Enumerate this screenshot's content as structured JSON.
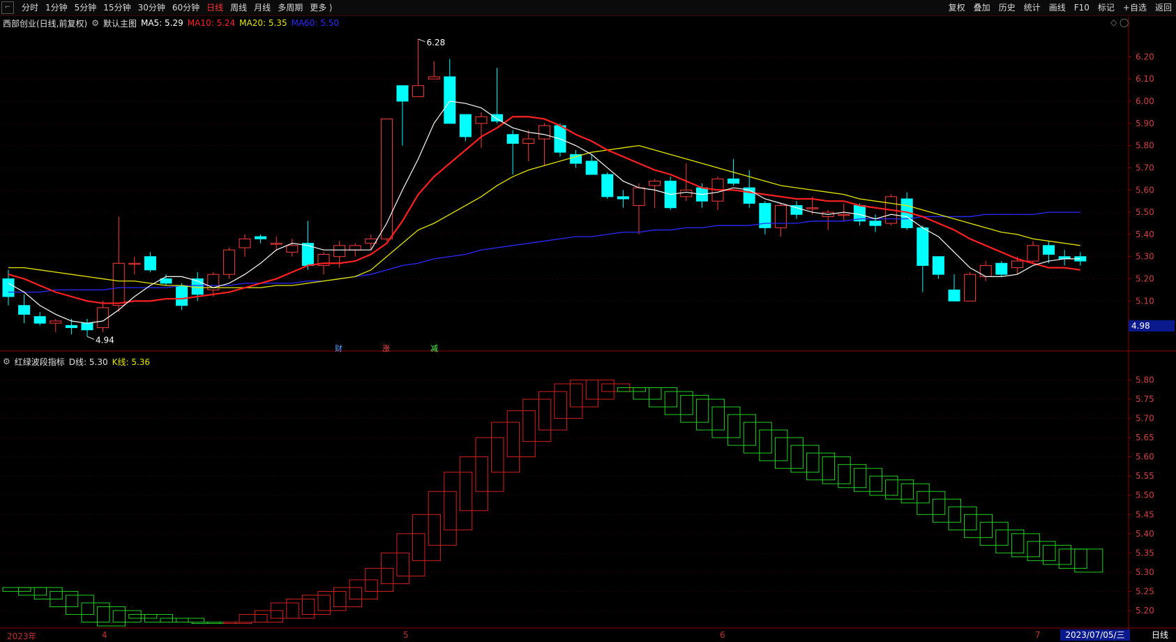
{
  "toolbar": {
    "left_tabs": [
      "分时",
      "1分钟",
      "5分钟",
      "15分钟",
      "30分钟",
      "60分钟",
      "日线",
      "周线",
      "月线",
      "多周期",
      "更多 ⟩"
    ],
    "active_tab": "日线",
    "right_buttons": [
      "复权",
      "叠加",
      "历史",
      "统计",
      "画线",
      "F10",
      "+自选",
      "返回"
    ],
    "right_buttons_note": "",
    "extra_right": "标记"
  },
  "main": {
    "stock_title": "西部创业(日线,前复权)",
    "main_chart_label": "默认主图",
    "ma5": "MA5: 5.29",
    "ma10": "MA10: 5.24",
    "ma20": "MA20: 5.35",
    "ma60": "MA60: 5.50",
    "high_label": "6.28",
    "low_label": "4.94",
    "price_badge": "4.98",
    "event_labels": [
      "财",
      "涨",
      "减"
    ]
  },
  "indicator": {
    "title": "红绿波段指标",
    "d_line": "D线: 5.30",
    "k_line": "K线: 5.36"
  },
  "xaxis": {
    "labels": [
      "2023年",
      "4",
      "5",
      "6",
      "7"
    ],
    "date_badge": "2023/07/05/三",
    "period": "日线"
  },
  "colors": {
    "up": "#ff3b3b",
    "down": "#00ffff",
    "ma5": "#ffffff",
    "ma10": "#ff2020",
    "ma20": "#e6e600",
    "ma60": "#2a2aff",
    "band_up": "#d42020",
    "band_down": "#20d020"
  },
  "chart_data": [
    {
      "type": "candlestick",
      "title": "西部创业(日线,前复权)",
      "y_ticks": [
        6.2,
        6.1,
        6.0,
        5.9,
        5.8,
        5.7,
        5.6,
        5.5,
        5.4,
        5.3,
        5.2,
        5.1
      ],
      "ylim": [
        4.9,
        6.33
      ],
      "candles": [
        {
          "o": 5.2,
          "h": 5.24,
          "l": 5.08,
          "c": 5.12
        },
        {
          "o": 5.08,
          "h": 5.13,
          "l": 5.0,
          "c": 5.04
        },
        {
          "o": 5.03,
          "h": 5.05,
          "l": 4.99,
          "c": 5.0
        },
        {
          "o": 5.0,
          "h": 5.02,
          "l": 4.96,
          "c": 5.01
        },
        {
          "o": 4.99,
          "h": 5.02,
          "l": 4.95,
          "c": 4.98
        },
        {
          "o": 5.0,
          "h": 5.02,
          "l": 4.94,
          "c": 4.97
        },
        {
          "o": 4.98,
          "h": 5.1,
          "l": 4.96,
          "c": 5.07
        },
        {
          "o": 5.08,
          "h": 5.48,
          "l": 5.05,
          "c": 5.27
        },
        {
          "o": 5.27,
          "h": 5.3,
          "l": 5.22,
          "c": 5.27
        },
        {
          "o": 5.3,
          "h": 5.32,
          "l": 5.23,
          "c": 5.24
        },
        {
          "o": 5.2,
          "h": 5.22,
          "l": 5.17,
          "c": 5.18
        },
        {
          "o": 5.17,
          "h": 5.18,
          "l": 5.06,
          "c": 5.08
        },
        {
          "o": 5.2,
          "h": 5.23,
          "l": 5.1,
          "c": 5.13
        },
        {
          "o": 5.15,
          "h": 5.23,
          "l": 5.12,
          "c": 5.22
        },
        {
          "o": 5.22,
          "h": 5.34,
          "l": 5.2,
          "c": 5.33
        },
        {
          "o": 5.34,
          "h": 5.4,
          "l": 5.3,
          "c": 5.38
        },
        {
          "o": 5.39,
          "h": 5.4,
          "l": 5.36,
          "c": 5.38
        },
        {
          "o": 5.36,
          "h": 5.39,
          "l": 5.33,
          "c": 5.36
        },
        {
          "o": 5.32,
          "h": 5.38,
          "l": 5.3,
          "c": 5.35
        },
        {
          "o": 5.36,
          "h": 5.46,
          "l": 5.24,
          "c": 5.26
        },
        {
          "o": 5.26,
          "h": 5.32,
          "l": 5.22,
          "c": 5.31
        },
        {
          "o": 5.3,
          "h": 5.37,
          "l": 5.25,
          "c": 5.35
        },
        {
          "o": 5.33,
          "h": 5.36,
          "l": 5.3,
          "c": 5.35
        },
        {
          "o": 5.36,
          "h": 5.4,
          "l": 5.33,
          "c": 5.38
        },
        {
          "o": 5.38,
          "h": 5.92,
          "l": 5.37,
          "c": 5.92
        },
        {
          "o": 6.07,
          "h": 6.07,
          "l": 5.8,
          "c": 6.0
        },
        {
          "o": 6.02,
          "h": 6.28,
          "l": 6.02,
          "c": 6.07
        },
        {
          "o": 6.1,
          "h": 6.18,
          "l": 6.1,
          "c": 6.11
        },
        {
          "o": 6.11,
          "h": 6.19,
          "l": 5.9,
          "c": 5.9
        },
        {
          "o": 5.94,
          "h": 5.94,
          "l": 5.82,
          "c": 5.84
        },
        {
          "o": 5.9,
          "h": 5.95,
          "l": 5.79,
          "c": 5.93
        },
        {
          "o": 5.94,
          "h": 6.15,
          "l": 5.9,
          "c": 5.91
        },
        {
          "o": 5.85,
          "h": 5.87,
          "l": 5.67,
          "c": 5.81
        },
        {
          "o": 5.81,
          "h": 5.87,
          "l": 5.73,
          "c": 5.83
        },
        {
          "o": 5.83,
          "h": 5.9,
          "l": 5.71,
          "c": 5.89
        },
        {
          "o": 5.89,
          "h": 5.9,
          "l": 5.75,
          "c": 5.77
        },
        {
          "o": 5.76,
          "h": 5.78,
          "l": 5.7,
          "c": 5.72
        },
        {
          "o": 5.73,
          "h": 5.76,
          "l": 5.67,
          "c": 5.67
        },
        {
          "o": 5.67,
          "h": 5.68,
          "l": 5.56,
          "c": 5.57
        },
        {
          "o": 5.57,
          "h": 5.6,
          "l": 5.52,
          "c": 5.56
        },
        {
          "o": 5.53,
          "h": 5.63,
          "l": 5.4,
          "c": 5.61
        },
        {
          "o": 5.62,
          "h": 5.65,
          "l": 5.52,
          "c": 5.64
        },
        {
          "o": 5.64,
          "h": 5.66,
          "l": 5.51,
          "c": 5.52
        },
        {
          "o": 5.57,
          "h": 5.72,
          "l": 5.55,
          "c": 5.6
        },
        {
          "o": 5.61,
          "h": 5.63,
          "l": 5.52,
          "c": 5.55
        },
        {
          "o": 5.55,
          "h": 5.66,
          "l": 5.51,
          "c": 5.65
        },
        {
          "o": 5.65,
          "h": 5.74,
          "l": 5.62,
          "c": 5.63
        },
        {
          "o": 5.61,
          "h": 5.69,
          "l": 5.52,
          "c": 5.54
        },
        {
          "o": 5.54,
          "h": 5.55,
          "l": 5.4,
          "c": 5.43
        },
        {
          "o": 5.43,
          "h": 5.54,
          "l": 5.39,
          "c": 5.53
        },
        {
          "o": 5.53,
          "h": 5.55,
          "l": 5.47,
          "c": 5.49
        },
        {
          "o": 5.52,
          "h": 5.57,
          "l": 5.49,
          "c": 5.52
        },
        {
          "o": 5.48,
          "h": 5.51,
          "l": 5.42,
          "c": 5.5
        },
        {
          "o": 5.49,
          "h": 5.54,
          "l": 5.46,
          "c": 5.49
        },
        {
          "o": 5.53,
          "h": 5.54,
          "l": 5.44,
          "c": 5.46
        },
        {
          "o": 5.46,
          "h": 5.49,
          "l": 5.41,
          "c": 5.44
        },
        {
          "o": 5.45,
          "h": 5.58,
          "l": 5.44,
          "c": 5.57
        },
        {
          "o": 5.56,
          "h": 5.59,
          "l": 5.42,
          "c": 5.43
        },
        {
          "o": 5.43,
          "h": 5.44,
          "l": 5.14,
          "c": 5.26
        },
        {
          "o": 5.3,
          "h": 5.3,
          "l": 5.2,
          "c": 5.22
        },
        {
          "o": 5.15,
          "h": 5.22,
          "l": 5.1,
          "c": 5.1
        },
        {
          "o": 5.1,
          "h": 5.23,
          "l": 5.1,
          "c": 5.22
        },
        {
          "o": 5.21,
          "h": 5.28,
          "l": 5.19,
          "c": 5.26
        },
        {
          "o": 5.27,
          "h": 5.28,
          "l": 5.21,
          "c": 5.22
        },
        {
          "o": 5.25,
          "h": 5.3,
          "l": 5.22,
          "c": 5.28
        },
        {
          "o": 5.28,
          "h": 5.37,
          "l": 5.27,
          "c": 5.35
        },
        {
          "o": 5.35,
          "h": 5.37,
          "l": 5.27,
          "c": 5.31
        },
        {
          "o": 5.3,
          "h": 5.33,
          "l": 5.26,
          "c": 5.29
        },
        {
          "o": 5.3,
          "h": 5.32,
          "l": 5.26,
          "c": 5.28
        }
      ],
      "ma5": [
        5.18,
        5.14,
        5.08,
        5.04,
        5.01,
        5.0,
        5.01,
        5.06,
        5.12,
        5.17,
        5.21,
        5.21,
        5.19,
        5.16,
        5.18,
        5.22,
        5.27,
        5.33,
        5.36,
        5.35,
        5.33,
        5.33,
        5.33,
        5.33,
        5.45,
        5.6,
        5.74,
        5.9,
        6.0,
        5.99,
        5.97,
        5.92,
        5.88,
        5.86,
        5.85,
        5.83,
        5.8,
        5.76,
        5.7,
        5.64,
        5.61,
        5.6,
        5.58,
        5.59,
        5.58,
        5.59,
        5.61,
        5.6,
        5.56,
        5.54,
        5.52,
        5.5,
        5.49,
        5.5,
        5.49,
        5.47,
        5.49,
        5.48,
        5.43,
        5.39,
        5.32,
        5.25,
        5.21,
        5.21,
        5.22,
        5.26,
        5.28,
        5.29,
        5.29
      ],
      "ma10": [
        5.22,
        5.2,
        5.17,
        5.14,
        5.12,
        5.1,
        5.09,
        5.09,
        5.1,
        5.1,
        5.11,
        5.11,
        5.12,
        5.13,
        5.14,
        5.16,
        5.18,
        5.2,
        5.23,
        5.26,
        5.27,
        5.27,
        5.28,
        5.31,
        5.36,
        5.46,
        5.58,
        5.66,
        5.72,
        5.78,
        5.84,
        5.88,
        5.93,
        5.93,
        5.92,
        5.89,
        5.85,
        5.82,
        5.78,
        5.75,
        5.72,
        5.69,
        5.67,
        5.64,
        5.61,
        5.6,
        5.6,
        5.59,
        5.58,
        5.57,
        5.56,
        5.56,
        5.55,
        5.55,
        5.53,
        5.52,
        5.51,
        5.5,
        5.48,
        5.45,
        5.42,
        5.38,
        5.35,
        5.32,
        5.29,
        5.27,
        5.25,
        5.25,
        5.24
      ],
      "ma20": [
        5.25,
        5.25,
        5.24,
        5.23,
        5.22,
        5.21,
        5.2,
        5.19,
        5.19,
        5.18,
        5.17,
        5.17,
        5.16,
        5.16,
        5.16,
        5.16,
        5.16,
        5.17,
        5.17,
        5.18,
        5.19,
        5.2,
        5.21,
        5.24,
        5.3,
        5.36,
        5.42,
        5.45,
        5.49,
        5.53,
        5.57,
        5.62,
        5.66,
        5.69,
        5.71,
        5.73,
        5.75,
        5.77,
        5.78,
        5.79,
        5.8,
        5.78,
        5.76,
        5.74,
        5.72,
        5.7,
        5.68,
        5.66,
        5.64,
        5.62,
        5.61,
        5.6,
        5.59,
        5.58,
        5.56,
        5.55,
        5.54,
        5.53,
        5.51,
        5.49,
        5.47,
        5.45,
        5.43,
        5.41,
        5.4,
        5.38,
        5.37,
        5.36,
        5.35
      ],
      "ma60": [
        5.14,
        5.14,
        5.14,
        5.15,
        5.15,
        5.15,
        5.15,
        5.16,
        5.16,
        5.16,
        5.16,
        5.17,
        5.17,
        5.17,
        5.17,
        5.18,
        5.18,
        5.18,
        5.18,
        5.19,
        5.19,
        5.2,
        5.21,
        5.22,
        5.24,
        5.26,
        5.27,
        5.29,
        5.3,
        5.31,
        5.33,
        5.34,
        5.35,
        5.36,
        5.37,
        5.38,
        5.39,
        5.39,
        5.4,
        5.41,
        5.41,
        5.42,
        5.42,
        5.43,
        5.43,
        5.44,
        5.44,
        5.44,
        5.45,
        5.45,
        5.45,
        5.46,
        5.46,
        5.46,
        5.47,
        5.47,
        5.47,
        5.47,
        5.48,
        5.48,
        5.48,
        5.48,
        5.49,
        5.49,
        5.49,
        5.49,
        5.5,
        5.5,
        5.5
      ]
    },
    {
      "type": "band-indicator",
      "title": "红绿波段指标",
      "y_ticks": [
        5.8,
        5.75,
        5.7,
        5.65,
        5.6,
        5.55,
        5.5,
        5.45,
        5.4,
        5.35,
        5.3,
        5.25,
        5.2
      ],
      "ylim": [
        5.16,
        5.83
      ],
      "bands": [
        {
          "d": 5.26,
          "k": 5.25,
          "dir": "down"
        },
        {
          "d": 5.26,
          "k": 5.24,
          "dir": "down"
        },
        {
          "d": 5.26,
          "k": 5.23,
          "dir": "down"
        },
        {
          "d": 5.25,
          "k": 5.21,
          "dir": "down"
        },
        {
          "d": 5.24,
          "k": 5.19,
          "dir": "down"
        },
        {
          "d": 5.22,
          "k": 5.17,
          "dir": "down"
        },
        {
          "d": 5.21,
          "k": 5.16,
          "dir": "down"
        },
        {
          "d": 5.2,
          "k": 5.17,
          "dir": "down"
        },
        {
          "d": 5.19,
          "k": 5.18,
          "dir": "down"
        },
        {
          "d": 5.19,
          "k": 5.17,
          "dir": "down"
        },
        {
          "d": 5.18,
          "k": 5.17,
          "dir": "down"
        },
        {
          "d": 5.18,
          "k": 5.17,
          "dir": "down"
        },
        {
          "d": 5.17,
          "k": 5.17,
          "dir": "down"
        },
        {
          "d": 5.17,
          "k": 5.17,
          "dir": "down"
        },
        {
          "d": 5.17,
          "k": 5.17,
          "dir": "up"
        },
        {
          "d": 5.17,
          "k": 5.19,
          "dir": "up"
        },
        {
          "d": 5.17,
          "k": 5.2,
          "dir": "up"
        },
        {
          "d": 5.18,
          "k": 5.22,
          "dir": "up"
        },
        {
          "d": 5.18,
          "k": 5.23,
          "dir": "up"
        },
        {
          "d": 5.19,
          "k": 5.24,
          "dir": "up"
        },
        {
          "d": 5.2,
          "k": 5.25,
          "dir": "up"
        },
        {
          "d": 5.21,
          "k": 5.26,
          "dir": "up"
        },
        {
          "d": 5.23,
          "k": 5.28,
          "dir": "up"
        },
        {
          "d": 5.25,
          "k": 5.31,
          "dir": "up"
        },
        {
          "d": 5.27,
          "k": 5.35,
          "dir": "up"
        },
        {
          "d": 5.29,
          "k": 5.4,
          "dir": "up"
        },
        {
          "d": 5.33,
          "k": 5.45,
          "dir": "up"
        },
        {
          "d": 5.37,
          "k": 5.51,
          "dir": "up"
        },
        {
          "d": 5.41,
          "k": 5.56,
          "dir": "up"
        },
        {
          "d": 5.46,
          "k": 5.6,
          "dir": "up"
        },
        {
          "d": 5.51,
          "k": 5.65,
          "dir": "up"
        },
        {
          "d": 5.56,
          "k": 5.69,
          "dir": "up"
        },
        {
          "d": 5.6,
          "k": 5.72,
          "dir": "up"
        },
        {
          "d": 5.64,
          "k": 5.75,
          "dir": "up"
        },
        {
          "d": 5.67,
          "k": 5.77,
          "dir": "up"
        },
        {
          "d": 5.7,
          "k": 5.79,
          "dir": "up"
        },
        {
          "d": 5.73,
          "k": 5.8,
          "dir": "up"
        },
        {
          "d": 5.75,
          "k": 5.8,
          "dir": "up"
        },
        {
          "d": 5.77,
          "k": 5.79,
          "dir": "up"
        },
        {
          "d": 5.78,
          "k": 5.77,
          "dir": "down"
        },
        {
          "d": 5.78,
          "k": 5.75,
          "dir": "down"
        },
        {
          "d": 5.78,
          "k": 5.73,
          "dir": "down"
        },
        {
          "d": 5.77,
          "k": 5.71,
          "dir": "down"
        },
        {
          "d": 5.76,
          "k": 5.69,
          "dir": "down"
        },
        {
          "d": 5.75,
          "k": 5.67,
          "dir": "down"
        },
        {
          "d": 5.73,
          "k": 5.65,
          "dir": "down"
        },
        {
          "d": 5.71,
          "k": 5.63,
          "dir": "down"
        },
        {
          "d": 5.69,
          "k": 5.61,
          "dir": "down"
        },
        {
          "d": 5.67,
          "k": 5.59,
          "dir": "down"
        },
        {
          "d": 5.65,
          "k": 5.57,
          "dir": "down"
        },
        {
          "d": 5.63,
          "k": 5.56,
          "dir": "down"
        },
        {
          "d": 5.61,
          "k": 5.54,
          "dir": "down"
        },
        {
          "d": 5.6,
          "k": 5.53,
          "dir": "down"
        },
        {
          "d": 5.58,
          "k": 5.52,
          "dir": "down"
        },
        {
          "d": 5.57,
          "k": 5.51,
          "dir": "down"
        },
        {
          "d": 5.55,
          "k": 5.5,
          "dir": "down"
        },
        {
          "d": 5.54,
          "k": 5.49,
          "dir": "down"
        },
        {
          "d": 5.53,
          "k": 5.48,
          "dir": "down"
        },
        {
          "d": 5.51,
          "k": 5.45,
          "dir": "down"
        },
        {
          "d": 5.49,
          "k": 5.43,
          "dir": "down"
        },
        {
          "d": 5.47,
          "k": 5.41,
          "dir": "down"
        },
        {
          "d": 5.45,
          "k": 5.39,
          "dir": "down"
        },
        {
          "d": 5.43,
          "k": 5.37,
          "dir": "down"
        },
        {
          "d": 5.41,
          "k": 5.35,
          "dir": "down"
        },
        {
          "d": 5.4,
          "k": 5.34,
          "dir": "down"
        },
        {
          "d": 5.38,
          "k": 5.33,
          "dir": "down"
        },
        {
          "d": 5.37,
          "k": 5.32,
          "dir": "down"
        },
        {
          "d": 5.36,
          "k": 5.31,
          "dir": "down"
        },
        {
          "d": 5.36,
          "k": 5.3,
          "dir": "down"
        }
      ]
    }
  ]
}
